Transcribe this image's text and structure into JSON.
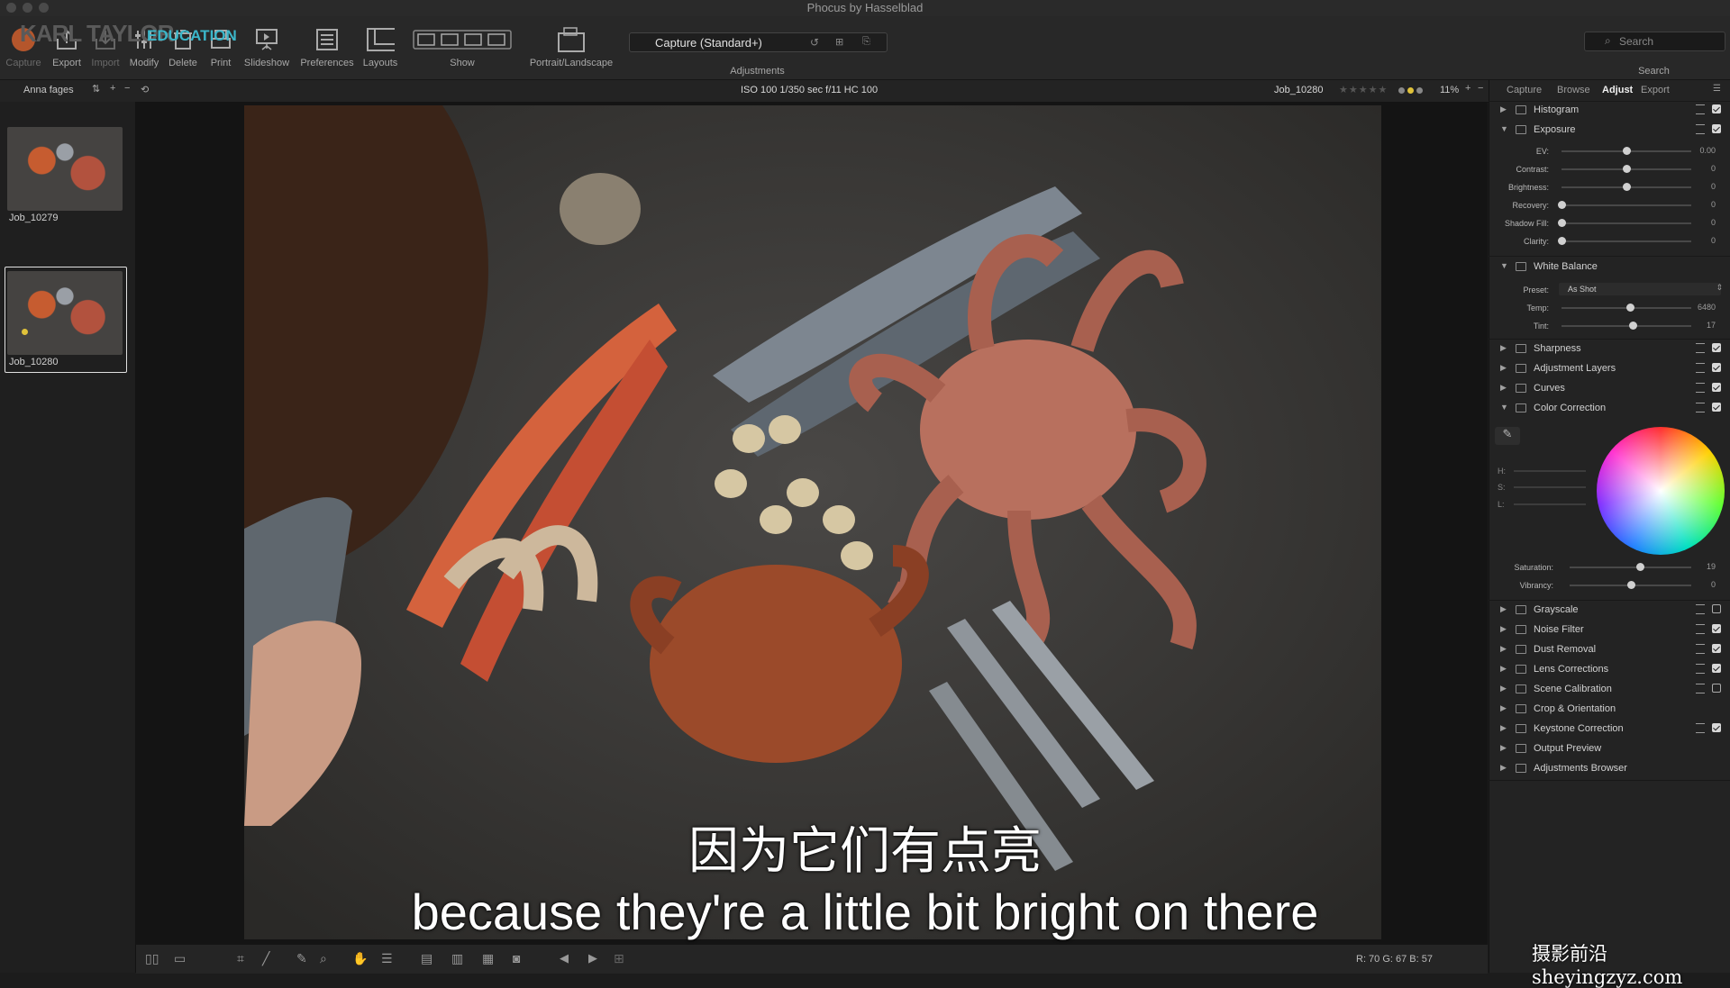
{
  "window": {
    "title": "Phocus by Hasselblad"
  },
  "branding": {
    "logo_text": "KARL TAYLOR",
    "logo_sub": "EDUCATION"
  },
  "toolbar": {
    "capture": "Capture",
    "export": "Export",
    "import": "Import",
    "modify": "Modify",
    "delete": "Delete",
    "print": "Print",
    "slideshow": "Slideshow",
    "preferences": "Preferences",
    "layouts": "Layouts",
    "show": "Show",
    "portrait_landscape": "Portrait/Landscape",
    "adjustments_dropdown": "Capture (Standard+)",
    "adjustments": "Adjustments",
    "search_placeholder": "Search",
    "search_label": "Search"
  },
  "subbar": {
    "folder": "Anna fages",
    "exif": "ISO 100  1/350 sec  f/11  HC 100",
    "image_name": "Job_10280",
    "zoom": "11%"
  },
  "browser": {
    "thumbs": [
      {
        "name": "Job_10279"
      },
      {
        "name": "Job_10280"
      }
    ]
  },
  "panel": {
    "tabs": [
      "Capture",
      "Browse",
      "Adjust",
      "Export"
    ],
    "tools": {
      "histogram": "Histogram",
      "exposure": "Exposure",
      "white_balance": "White Balance",
      "sharpness": "Sharpness",
      "adjustment_layers": "Adjustment Layers",
      "curves": "Curves",
      "color_correction": "Color Correction",
      "grayscale": "Grayscale",
      "noise_filter": "Noise Filter",
      "dust_removal": "Dust Removal",
      "lens_corrections": "Lens Corrections",
      "scene_calibration": "Scene Calibration",
      "crop_orientation": "Crop & Orientation",
      "keystone_correction": "Keystone Correction",
      "output_preview": "Output Preview",
      "adjustments_browser": "Adjustments Browser"
    },
    "exposure": {
      "ev": {
        "label": "EV:",
        "value": "0.00",
        "level": 0.5
      },
      "contrast": {
        "label": "Contrast:",
        "value": "0",
        "level": 0.5
      },
      "brightness": {
        "label": "Brightness:",
        "value": "0",
        "level": 0.5
      },
      "recovery": {
        "label": "Recovery:",
        "value": "0",
        "level": 0.0
      },
      "shadow_fill": {
        "label": "Shadow Fill:",
        "value": "0",
        "level": 0.0
      },
      "clarity": {
        "label": "Clarity:",
        "value": "0",
        "level": 0.0
      }
    },
    "white_balance": {
      "preset_label": "Preset:",
      "preset_value": "As Shot",
      "temp": {
        "label": "Temp:",
        "value": "6480",
        "level": 0.53
      },
      "tint": {
        "label": "Tint:",
        "value": "17",
        "level": 0.55
      }
    },
    "color_correction": {
      "h_label": "H:",
      "s_label": "S:",
      "l_label": "L:",
      "saturation": {
        "label": "Saturation:",
        "value": "19",
        "level": 0.58
      },
      "vibrancy": {
        "label": "Vibrancy:",
        "value": "0",
        "level": 0.5
      }
    }
  },
  "statusbar": {
    "readout": "R:  70  G:  67  B:  57"
  },
  "subtitles": {
    "chinese": "因为它们有点亮",
    "english": "because they're a little bit bright on there"
  },
  "watermark": "摄影前沿 sheyingzyz.com"
}
